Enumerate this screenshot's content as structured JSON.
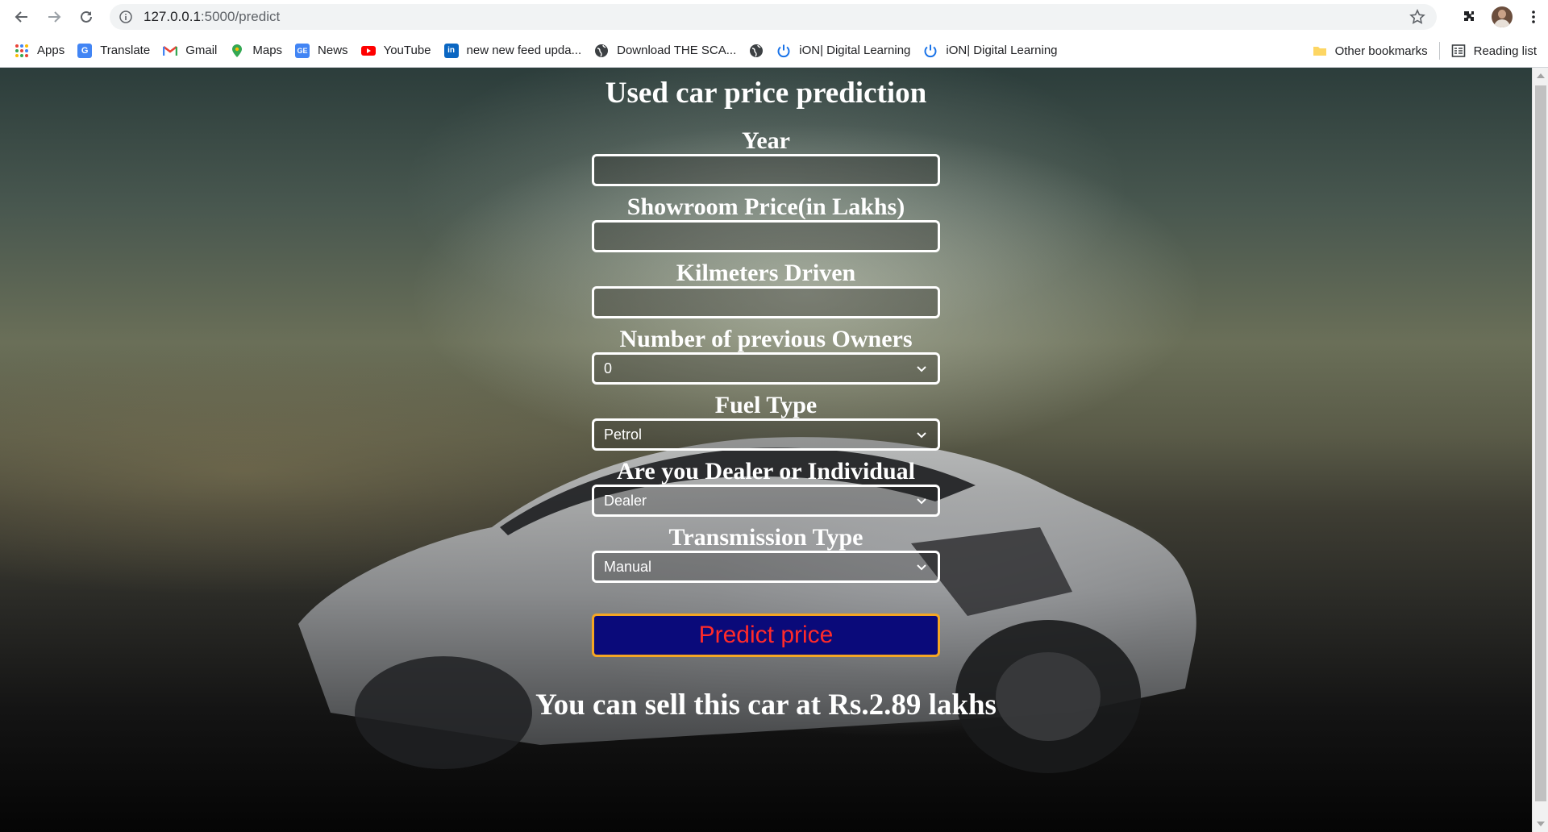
{
  "browser": {
    "url_host": "127.0.0.1",
    "url_path": ":5000/predict",
    "bookmarks": [
      {
        "label": "Apps",
        "icon": "apps-grid-icon"
      },
      {
        "label": "Translate",
        "icon": "translate-icon"
      },
      {
        "label": "Gmail",
        "icon": "gmail-icon"
      },
      {
        "label": "Maps",
        "icon": "maps-icon"
      },
      {
        "label": "News",
        "icon": "news-icon"
      },
      {
        "label": "YouTube",
        "icon": "youtube-icon"
      },
      {
        "label": "new new feed upda...",
        "icon": "linkedin-icon"
      },
      {
        "label": "Download THE SCA...",
        "icon": "globe-icon"
      },
      {
        "label": "",
        "icon": "globe-icon"
      },
      {
        "label": "iON| Digital Learning",
        "icon": "power-icon"
      },
      {
        "label": "iON| Digital Learning",
        "icon": "power-icon"
      }
    ],
    "other_bookmarks": "Other bookmarks",
    "reading_list": "Reading list"
  },
  "page": {
    "title": "Used car price prediction",
    "fields": {
      "year_label": "Year",
      "year_value": "",
      "price_label": "Showroom Price(in Lakhs)",
      "price_value": "",
      "km_label": "Kilmeters Driven",
      "km_value": "",
      "owners_label": "Number of previous Owners",
      "owners_value": "0",
      "fuel_label": "Fuel Type",
      "fuel_value": "Petrol",
      "seller_label": "Are you Dealer or Individual",
      "seller_value": "Dealer",
      "transmission_label": "Transmission Type",
      "transmission_value": "Manual"
    },
    "predict_button": "Predict price",
    "result": "You can sell this car at Rs.2.89 lakhs"
  },
  "colors": {
    "button_bg": "#0a0a7a",
    "button_border": "#f5a623",
    "button_text": "#ff2a2a"
  }
}
